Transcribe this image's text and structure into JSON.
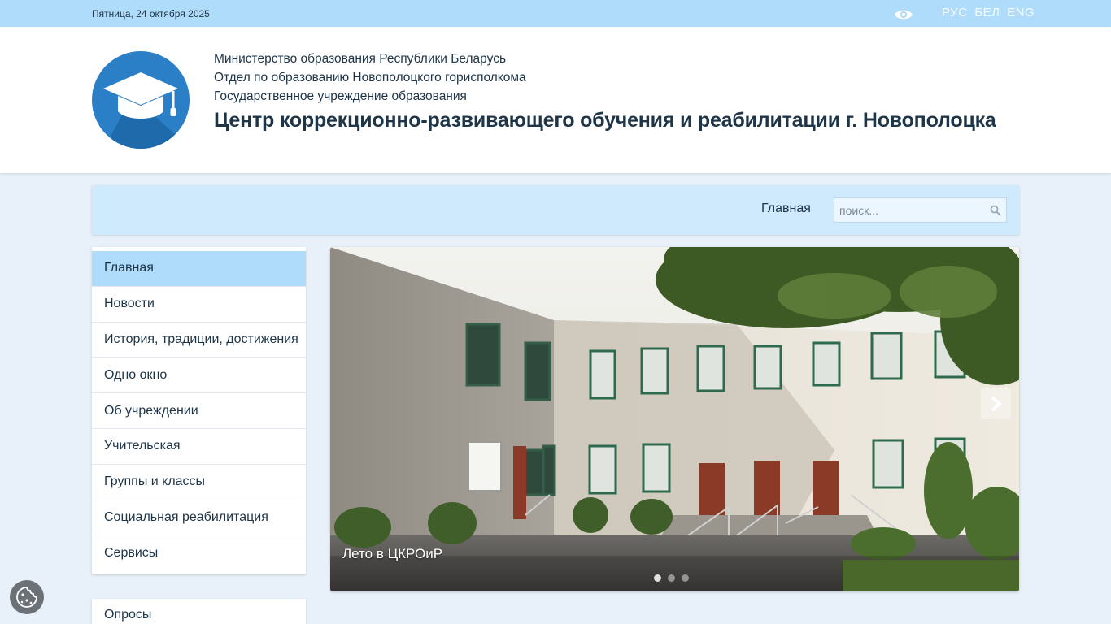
{
  "topbar": {
    "date": "Пятница, 24 октября 2025",
    "eye_icon": "eye-icon",
    "languages": [
      "РУС",
      "БЕЛ",
      "ENG"
    ]
  },
  "header": {
    "logo_icon": "graduation-cap-icon",
    "line1": "Министерство образования Республики Беларусь",
    "line2": "Отдел по образованию Новополоцкого горисполкома",
    "line3": "Государственное учреждение образования",
    "title": "Центр коррекционно-развивающего обучения и реабилитации г. Новополоцка"
  },
  "navbar": {
    "home": "Главная",
    "search_placeholder": "поиск...",
    "search_icon": "search-icon"
  },
  "sidebar": {
    "items": [
      {
        "label": "Главная",
        "active": true
      },
      {
        "label": "Новости"
      },
      {
        "label": "История, традиции, достижения"
      },
      {
        "label": "Одно окно"
      },
      {
        "label": "Об учреждении"
      },
      {
        "label": "Учительская"
      },
      {
        "label": "Группы и классы"
      },
      {
        "label": "Социальная реабилитация"
      },
      {
        "label": "Сервисы"
      }
    ],
    "polls_label": "Опросы"
  },
  "slider": {
    "caption": "Лето в ЦКРОиР",
    "next_icon": "chevron-right-icon",
    "active_dot": 0,
    "dot_count": 3
  },
  "cookie": {
    "icon": "cookie-icon"
  },
  "colors": {
    "topbar": "#b0dcfb",
    "navbar": "#cfe9fd",
    "active_item": "#b0dcfb",
    "logo": "#2b7fc6",
    "text": "#1e3447"
  }
}
